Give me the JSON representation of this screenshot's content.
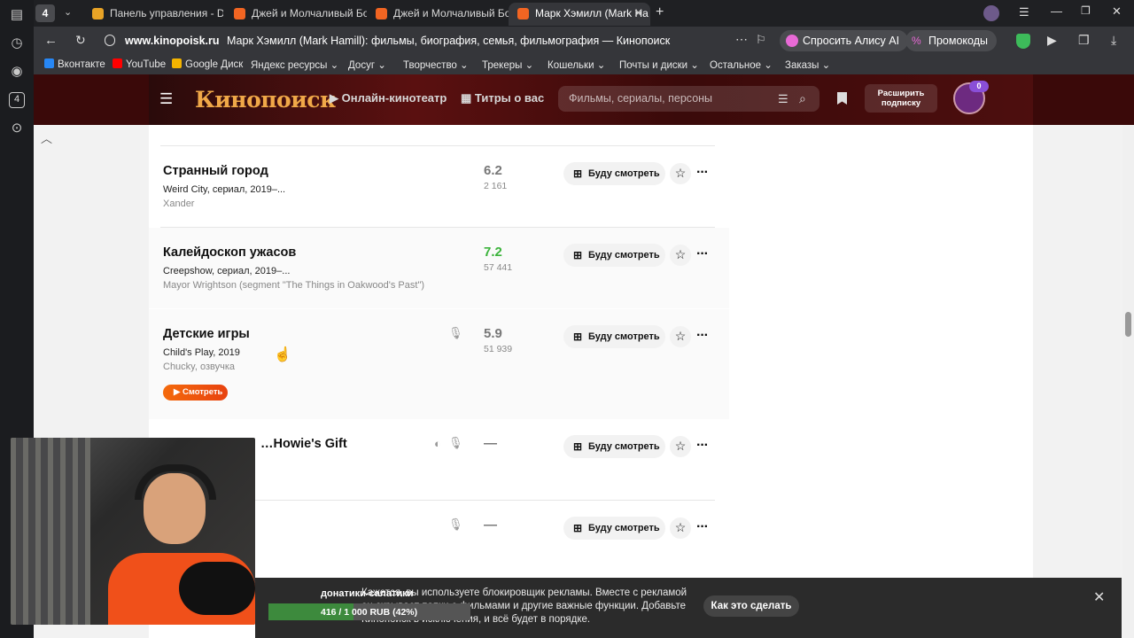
{
  "browser": {
    "tab_count": "4",
    "tabs": [
      {
        "label": "Панель управления - Don",
        "color": "#e8a326"
      },
      {
        "label": "Джей и Молчаливый Боб",
        "color": "#f26522"
      },
      {
        "label": "Джей и Молчаливый Боб",
        "color": "#f26522"
      },
      {
        "label": "Марк Хэмилл (Mark Ha",
        "color": "#f26522"
      }
    ],
    "domain": "www.kinopoisk.ru",
    "page_title": "Марк Хэмилл (Mark Hamill): фильмы, биография, семья, фильмография — Кинопоиск",
    "alice_label": "Спросить Алису AI",
    "promo_label": "Промокоды",
    "sidebar_badge": "4",
    "bookmarks": [
      "Вконтакте",
      "YouTube",
      "Google Диск",
      "Яндекс ресурсы",
      "Досуг",
      "Творчество",
      "Трекеры",
      "Кошельки",
      "Почты и диски",
      "Остальное",
      "Заказы"
    ]
  },
  "kp": {
    "logo": "Кинопоиск",
    "nav_online": "Онлайн-кинотеатр",
    "nav_titles": "Титры о вас",
    "search_placeholder": "Фильмы, сериалы, персоны",
    "subscribe_label_1": "Расширить",
    "subscribe_label_2": "подписку",
    "avatar_badge": "0"
  },
  "films": [
    {
      "title": "Странный город",
      "sub": "Weird City, сериал, 2019–...",
      "role": "Xander",
      "rating": "6.2",
      "votes": "2 161",
      "rating_color": "gray"
    },
    {
      "title": "Калейдоскоп ужасов",
      "sub": "Creepshow, сериал, 2019–...",
      "role": "Mayor Wrightson (segment \"The Things in Oakwood's Past\")",
      "rating": "7.2",
      "votes": "57 441",
      "rating_color": "green"
    },
    {
      "title": "Детские игры",
      "sub": "Child's Play, 2019",
      "role": "Chucky, озвучка",
      "rating": "5.9",
      "votes": "51 939",
      "rating_color": "gray",
      "watch_label": "Смотреть"
    },
    {
      "title": "…Howie's Gift",
      "rating": "—"
    },
    {
      "title": "",
      "rating": "—"
    }
  ],
  "watchlist_label": "Буду смотреть",
  "ad": {
    "text": "Кажется, вы используете блокировщик рекламы. Вместе с рекламой он скрывает папки с фильмами и другие важные функции. Добавьте Кинопоиск в исключения, и всё будет в порядке.",
    "button": "Как это сделать",
    "donor_title": "донатики-салатики",
    "donor_progress": "416 / 1 000 RUB (42%)",
    "donor_fraction": 0.42
  }
}
